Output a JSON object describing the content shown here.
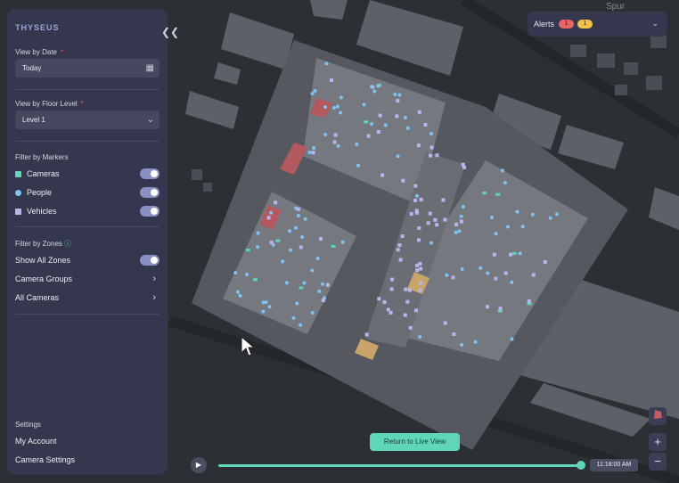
{
  "app": {
    "logo": "THYSEUS"
  },
  "sidebar": {
    "view_by_date_label": "View by Date",
    "date_value": "Today",
    "view_by_floor_label": "View by Floor Level",
    "floor_value": "Level 1",
    "required_mark": "*",
    "filter_markers_label": "Filter by Markers",
    "markers": [
      {
        "label": "Cameras",
        "color": "#5fd6b7"
      },
      {
        "label": "People",
        "color": "#7fc3f0"
      },
      {
        "label": "Vehicles",
        "color": "#b8b4ee"
      }
    ],
    "filter_zones_label": "Filter by Zones",
    "zones": {
      "show_all": "Show All Zones",
      "camera_groups": "Camera Groups",
      "all_cameras": "All Cameras"
    },
    "settings_label": "Settings",
    "my_account": "My Account",
    "camera_settings": "Camera Settings"
  },
  "alerts": {
    "label": "Alerts",
    "red_count": "1",
    "yellow_count": "1"
  },
  "playback": {
    "return_live": "Return to Live View",
    "time": "11:18:00 AM",
    "progress": 0.99
  },
  "map": {
    "street_label": "Spur"
  },
  "colors": {
    "accent": "#5fd6b7",
    "panel": "#34374d",
    "toggle": "#8a8fc4",
    "alert_red": "#e66464",
    "alert_yellow": "#f1c24a"
  }
}
